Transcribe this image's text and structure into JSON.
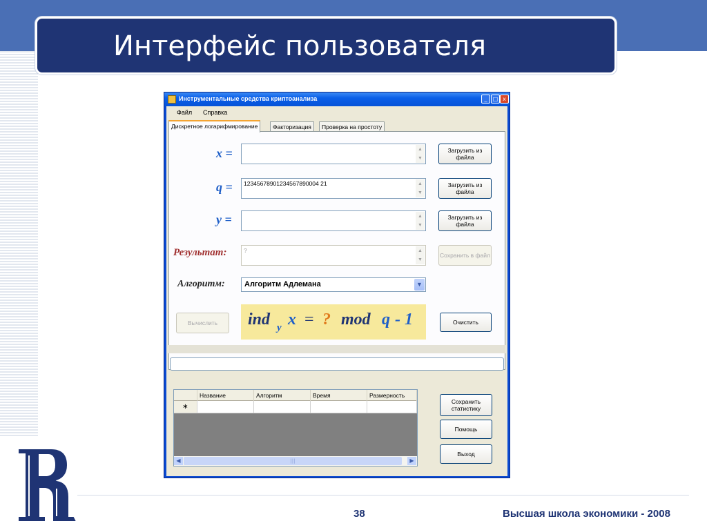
{
  "slide": {
    "title": "Интерфейс пользователя",
    "page_number": "38",
    "footer": "Высшая школа экономики - 2008"
  },
  "window": {
    "title": "Инструментальные средства криптоанализа",
    "controls": [
      "_",
      "□",
      "x"
    ]
  },
  "menu": {
    "items": [
      "Файл",
      "Справка"
    ]
  },
  "tabs": [
    {
      "label": "Дискретное логарифмирование",
      "active": true
    },
    {
      "label": "Факторизация",
      "active": false
    },
    {
      "label": "Проверка на простоту",
      "active": false
    }
  ],
  "fields": {
    "x": {
      "label": "x =",
      "value": "",
      "button": "Загрузить из файла"
    },
    "q": {
      "label": "q =",
      "value": "12345678901234567890004 21",
      "button": "Загрузить из файла"
    },
    "y": {
      "label": "y =",
      "value": "",
      "button": "Загрузить из файла"
    },
    "result": {
      "label": "Результат:",
      "value": "?",
      "button": "Сохранить в файл"
    }
  },
  "algorithm": {
    "label": "Алгоритм:",
    "selected": "Алгоритм Адлемана"
  },
  "formula": {
    "ind": "ind",
    "sub": "y",
    "x": "x",
    "eq": "=",
    "q_mark": "?",
    "mod": "mod",
    "q": "q",
    "minus_one": "- 1"
  },
  "buttons": {
    "compute": "Вычислить",
    "clear": "Очистить",
    "save_stats": "Сохранить статистику",
    "help": "Помощь",
    "exit": "Выход"
  },
  "table": {
    "columns": [
      "Название",
      "Алгоритм",
      "Время",
      "Размерность"
    ],
    "new_row_marker": "∗"
  },
  "colors": {
    "title_box": "#1f3474",
    "window_titlebar": "#0a5fe8",
    "variable_label": "#1f5fc8",
    "result_label": "#a03030",
    "formula_bg": "#f7e99c",
    "formula_accent": "#e07a1c"
  },
  "icons": [
    "app-icon",
    "minimize-icon",
    "maximize-icon",
    "close-icon",
    "scroll-up-icon",
    "scroll-down-icon",
    "dropdown-arrow-icon",
    "scroll-left-icon",
    "scroll-right-icon"
  ]
}
